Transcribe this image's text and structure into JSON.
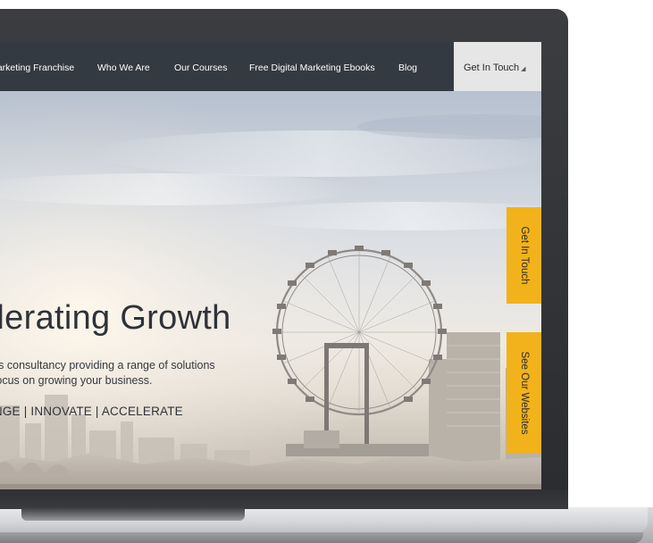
{
  "nav": {
    "items": [
      {
        "label": "al Marketing Franchise"
      },
      {
        "label": "Who We Are"
      },
      {
        "label": "Our Courses"
      },
      {
        "label": "Free Digital Marketing Ebooks"
      },
      {
        "label": "Blog"
      }
    ],
    "cta_label": "Get In Touch"
  },
  "hero": {
    "title": "elerating Growth",
    "description_line1": "ness consultancy providing a range of solutions",
    "description_line2": "at focus on growing your business.",
    "tagline": "LENGE | INNOVATE | ACCELERATE"
  },
  "side_tabs": {
    "get_in_touch": "Get In Touch",
    "see_our_websites": "See Our Websites"
  },
  "colors": {
    "nav_background": "#343a41",
    "accent": "#f2b21c",
    "cta_background": "#e6e6e6"
  },
  "icons": {
    "nav_cta_caret": "caret-icon"
  }
}
